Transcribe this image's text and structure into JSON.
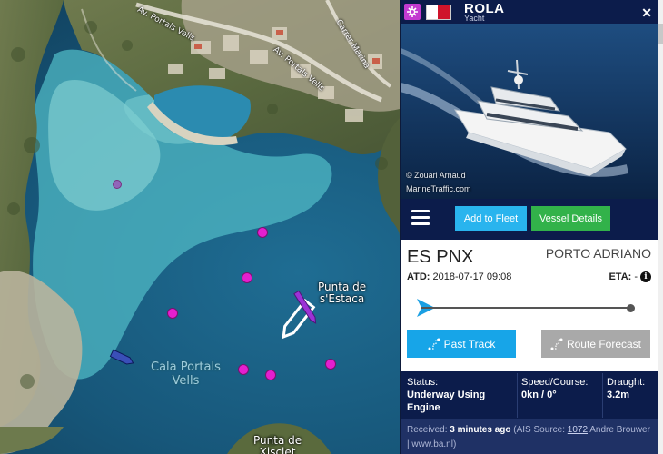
{
  "map": {
    "streets": [
      "Av. Portals Vells",
      "Av. Portals Vells",
      "Carrer Marina"
    ],
    "places": [
      "Punta de\ns'Estaca",
      "Punta de\nXisclet"
    ],
    "bay_name": "Cala Portals\nVells",
    "colors": {
      "vessel_marker": "#e51fcf",
      "selected_vessel": "#ffffff",
      "boat_marker": "#3a4fb8"
    }
  },
  "panel": {
    "vessel_name": "ROLA",
    "vessel_type": "Yacht",
    "close_icon": "close-icon",
    "photo_credit_line1": "© Zouari Arnaud",
    "photo_credit_line2": "MarineTraffic.com",
    "add_to_fleet": "Add to Fleet",
    "vessel_details": "Vessel Details",
    "origin": "ES PNX",
    "destination": "PORTO ADRIANO",
    "atd_label": "ATD:",
    "atd_value": "2018-07-17 09:08",
    "eta_label": "ETA:",
    "eta_value": "-",
    "past_track": "Past Track",
    "route_forecast": "Route Forecast",
    "status_label": "Status:",
    "status_value": "Underway Using Engine",
    "speed_label": "Speed/Course:",
    "speed_value": "0kn / 0°",
    "draught_label": "Draught:",
    "draught_value": "3.2m",
    "received_prefix": "Received:",
    "received_time": "3 minutes ago",
    "ais_prefix": "(AIS Source:",
    "ais_source_id": "1072",
    "ais_source_name": "Andre Brouwer | www.ba.nl)",
    "colors": {
      "header": "#0c1c4b",
      "fleet_btn": "#29b4ee",
      "details_btn": "#32b24a",
      "past_btn": "#17a5e8",
      "route_btn": "#a9a9a9"
    }
  }
}
